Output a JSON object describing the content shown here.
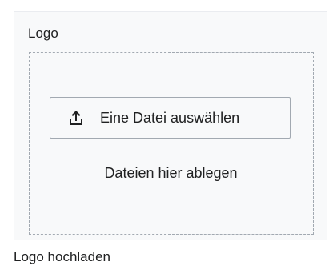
{
  "field": {
    "label": "Logo"
  },
  "upload": {
    "button_label": "Eine Datei auswählen",
    "button_icon": "upload-icon",
    "drop_hint": "Dateien hier ablegen"
  },
  "help": {
    "text": "Logo hochladen"
  },
  "colors": {
    "panel_background": "#f8f9fa",
    "border": "#a2a9b1",
    "text": "#202122"
  }
}
